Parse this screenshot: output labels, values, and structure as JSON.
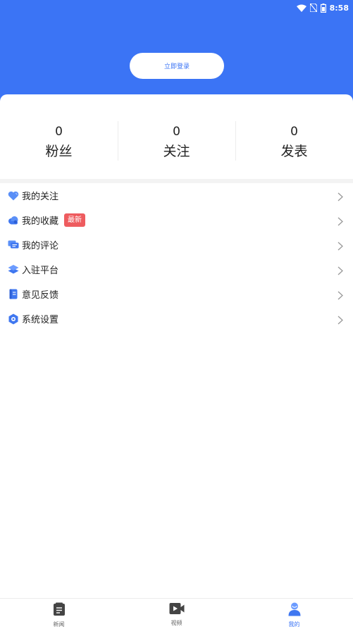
{
  "status": {
    "time": "8:58"
  },
  "header": {
    "login_label": "立即登录"
  },
  "stats": [
    {
      "value": "0",
      "label": "粉丝"
    },
    {
      "value": "0",
      "label": "关注"
    },
    {
      "value": "0",
      "label": "发表"
    }
  ],
  "menu": {
    "items": [
      {
        "label": "我的关注",
        "icon": "heart-icon"
      },
      {
        "label": "我的收藏",
        "icon": "cloud-icon",
        "badge": "最新"
      },
      {
        "label": "我的评论",
        "icon": "comment-icon"
      },
      {
        "label": "入驻平台",
        "icon": "layers-icon"
      },
      {
        "label": "意见反馈",
        "icon": "document-icon"
      },
      {
        "label": "系统设置",
        "icon": "settings-icon"
      }
    ]
  },
  "tabbar": {
    "items": [
      {
        "label": "新闻",
        "icon": "news-icon"
      },
      {
        "label": "视频",
        "icon": "video-icon"
      },
      {
        "label": "我的",
        "icon": "user-icon",
        "active": true
      }
    ]
  },
  "colors": {
    "primary": "#3b74f5",
    "badge": "#ee5c5f"
  }
}
